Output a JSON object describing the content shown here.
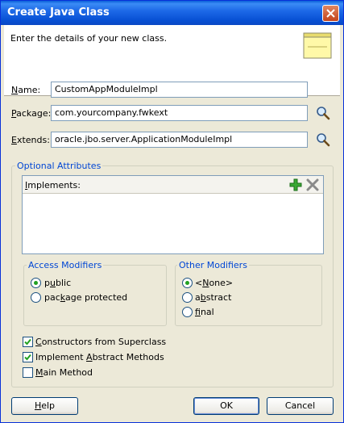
{
  "window": {
    "title": "Create Java Class"
  },
  "header": {
    "intro": "Enter the details of your new class."
  },
  "fields": {
    "name": {
      "label_pre": "",
      "label_key": "N",
      "label_post": "ame:",
      "value": "CustomAppModuleImpl"
    },
    "package": {
      "label_pre": "",
      "label_key": "P",
      "label_post": "ackage:",
      "value": "com.yourcompany.fwkext"
    },
    "extends": {
      "label_pre": "",
      "label_key": "E",
      "label_post": "xtends:",
      "value": "oracle.jbo.server.ApplicationModuleImpl"
    }
  },
  "optional": {
    "title": "Optional Attributes",
    "implements_pre": "",
    "implements_key": "I",
    "implements_post": "mplements:",
    "access": {
      "title": "Access Modifiers",
      "public_pre": "p",
      "public_key": "u",
      "public_post": "blic",
      "package_pre": "pac",
      "package_key": "k",
      "package_post": "age protected"
    },
    "other": {
      "title": "Other Modifiers",
      "none_pre": "<",
      "none_key": "N",
      "none_post": "one>",
      "abstract_pre": "a",
      "abstract_key": "b",
      "abstract_post": "stract",
      "final_pre": "",
      "final_key": "f",
      "final_post": "inal"
    },
    "checks": {
      "constructors_pre": "",
      "constructors_key": "C",
      "constructors_post": "onstructors from Superclass",
      "abstract_pre": "Implement ",
      "abstract_key": "A",
      "abstract_post": "bstract Methods",
      "main_pre": "",
      "main_key": "M",
      "main_post": "ain Method"
    }
  },
  "buttons": {
    "help_pre": "",
    "help_key": "H",
    "help_post": "elp",
    "ok": "OK",
    "cancel": "Cancel"
  },
  "colors": {
    "accent": "#0046d5",
    "titlebar": "#0a5fd8",
    "radio_dot": "#21a121"
  }
}
